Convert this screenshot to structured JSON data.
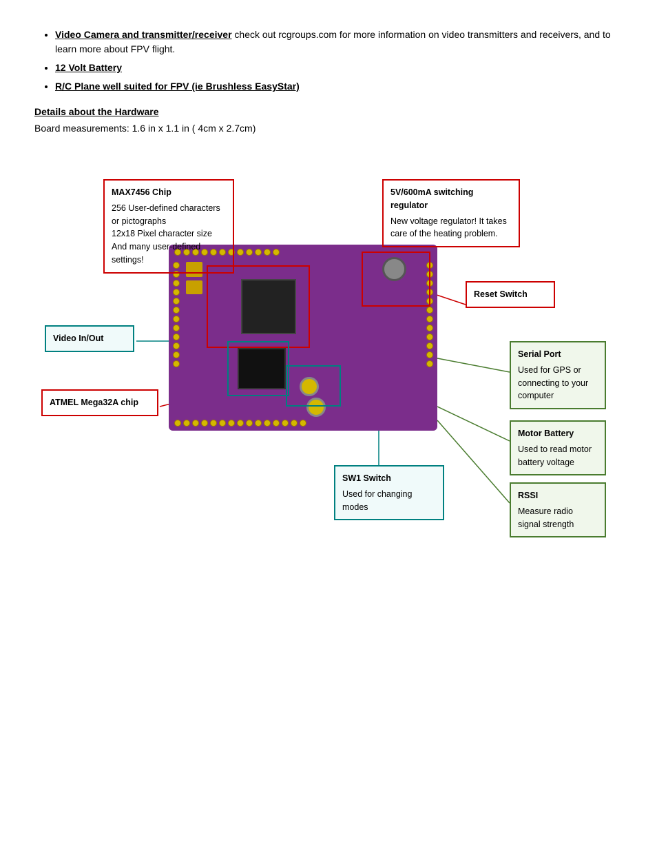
{
  "bullets": [
    {
      "text_bold": "Video Camera and transmitter/receiver",
      "text_normal": "  check out rcgroups.com for more information on video transmitters and receivers, and to learn more about FPV flight."
    },
    {
      "text_bold": "12 Volt Battery",
      "text_normal": ""
    },
    {
      "text_bold": "R/C Plane well suited for FPV (ie Brushless EasyStar)",
      "text_normal": ""
    }
  ],
  "section_title": "Details about the Hardware",
  "board_measurements": "Board measurements: 1.6 in x 1.1 in ( 4cm x 2.7cm)",
  "annotations": {
    "max7456": {
      "title": "MAX7456 Chip",
      "lines": [
        "256 User-defined characters or pictographs",
        "12x18 Pixel character size",
        "And many user-defined settings!"
      ]
    },
    "regulator": {
      "title": "5V/600mA switching regulator",
      "lines": [
        "New voltage regulator! It takes care of the heating problem."
      ]
    },
    "video_inout": {
      "title": "Video In/Out"
    },
    "reset_switch": {
      "title": "Reset Switch"
    },
    "serial_port": {
      "title": "Serial Port",
      "lines": [
        "Used for GPS or connecting to your computer"
      ]
    },
    "motor_battery": {
      "title": "Motor Battery",
      "lines": [
        "Used to read motor battery voltage"
      ]
    },
    "atmel": {
      "title": "ATMEL Mega32A chip"
    },
    "sw1_switch": {
      "title": "SW1 Switch",
      "lines": [
        "Used for changing modes"
      ]
    },
    "rssi": {
      "title": "RSSI",
      "lines": [
        "Measure radio signal strength"
      ]
    }
  }
}
